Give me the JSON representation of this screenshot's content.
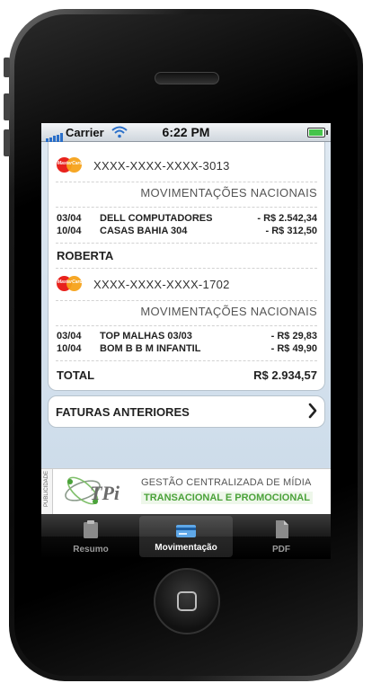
{
  "status_bar": {
    "carrier": "Carrier",
    "time": "6:22 PM"
  },
  "card1": {
    "brand": "MasterCard",
    "number": "XXXX-XXXX-XXXX-3013",
    "section_title": "MOVIMENTAÇÕES NACIONAIS",
    "transactions": [
      {
        "date": "03/04",
        "description": "DELL COMPUTADORES",
        "amount": "- R$ 2.542,34"
      },
      {
        "date": "10/04",
        "description": "CASAS BAHIA 304",
        "amount": "- R$ 312,50"
      }
    ]
  },
  "holder2": "ROBERTA",
  "card2": {
    "brand": "MasterCard",
    "number": "XXXX-XXXX-XXXX-1702",
    "section_title": "MOVIMENTAÇÕES NACIONAIS",
    "transactions": [
      {
        "date": "03/04",
        "description": "TOP MALHAS 03/03",
        "amount": "- R$ 29,83"
      },
      {
        "date": "10/04",
        "description": "BOM B B M INFANTIL",
        "amount": "- R$ 49,90"
      }
    ]
  },
  "total": {
    "label": "TOTAL",
    "value": "R$ 2.934,57"
  },
  "faturas_button": {
    "label": "FATURAS ANTERIORES"
  },
  "ad": {
    "tag": "PUBLICIDADE",
    "logo_text": "TPi",
    "line1": "GESTÃO CENTRALIZADA DE MÍDIA",
    "line2": "TRANSACIONAL E PROMOCIONAL"
  },
  "tabs": [
    {
      "label": "Resumo",
      "icon": "clipboard-icon",
      "active": false
    },
    {
      "label": "Movimentação",
      "icon": "credit-card-icon",
      "active": true
    },
    {
      "label": "PDF",
      "icon": "document-icon",
      "active": false
    }
  ],
  "colors": {
    "accent_green": "#4ba23a",
    "battery": "#46c44b",
    "signal": "#2a6fc9"
  }
}
